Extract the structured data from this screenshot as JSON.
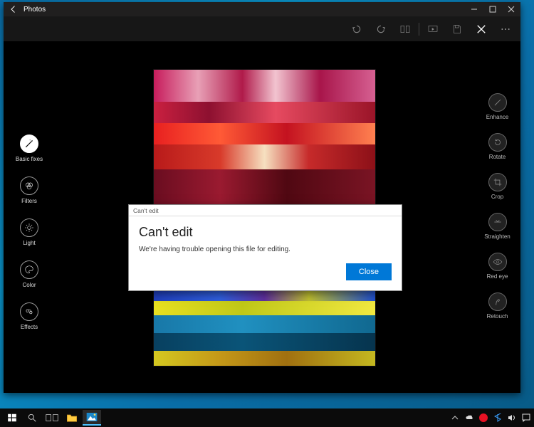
{
  "window": {
    "title": "Photos",
    "caption_buttons": {
      "minimize": "minimize",
      "maximize": "maximize",
      "close": "close"
    }
  },
  "actionbar": {
    "undo": "Undo",
    "redo": "Redo",
    "compare": "Compare",
    "play": "Play",
    "save": "Save",
    "close_edit": "Close",
    "more": "More"
  },
  "left_tools": [
    {
      "id": "basic-fixes",
      "label": "Basic fixes",
      "icon": "wand",
      "selected": true
    },
    {
      "id": "filters",
      "label": "Filters",
      "icon": "circles",
      "selected": false
    },
    {
      "id": "light",
      "label": "Light",
      "icon": "sun",
      "selected": false
    },
    {
      "id": "color",
      "label": "Color",
      "icon": "palette",
      "selected": false
    },
    {
      "id": "effects",
      "label": "Effects",
      "icon": "spiral",
      "selected": false
    }
  ],
  "right_tools": [
    {
      "id": "enhance",
      "label": "Enhance",
      "icon": "wand"
    },
    {
      "id": "rotate",
      "label": "Rotate",
      "icon": "rotate"
    },
    {
      "id": "crop",
      "label": "Crop",
      "icon": "crop"
    },
    {
      "id": "straighten",
      "label": "Straighten",
      "icon": "level"
    },
    {
      "id": "red-eye",
      "label": "Red eye",
      "icon": "eye"
    },
    {
      "id": "retouch",
      "label": "Retouch",
      "icon": "finger"
    }
  ],
  "dialog": {
    "caption": "Can't edit",
    "heading": "Can't edit",
    "message": "We're having trouble opening this file for editing.",
    "close_label": "Close"
  },
  "taskbar": {
    "start": "Start",
    "search": "Search",
    "taskview": "Task view",
    "file_explorer": "File Explorer",
    "photos": "Photos"
  }
}
